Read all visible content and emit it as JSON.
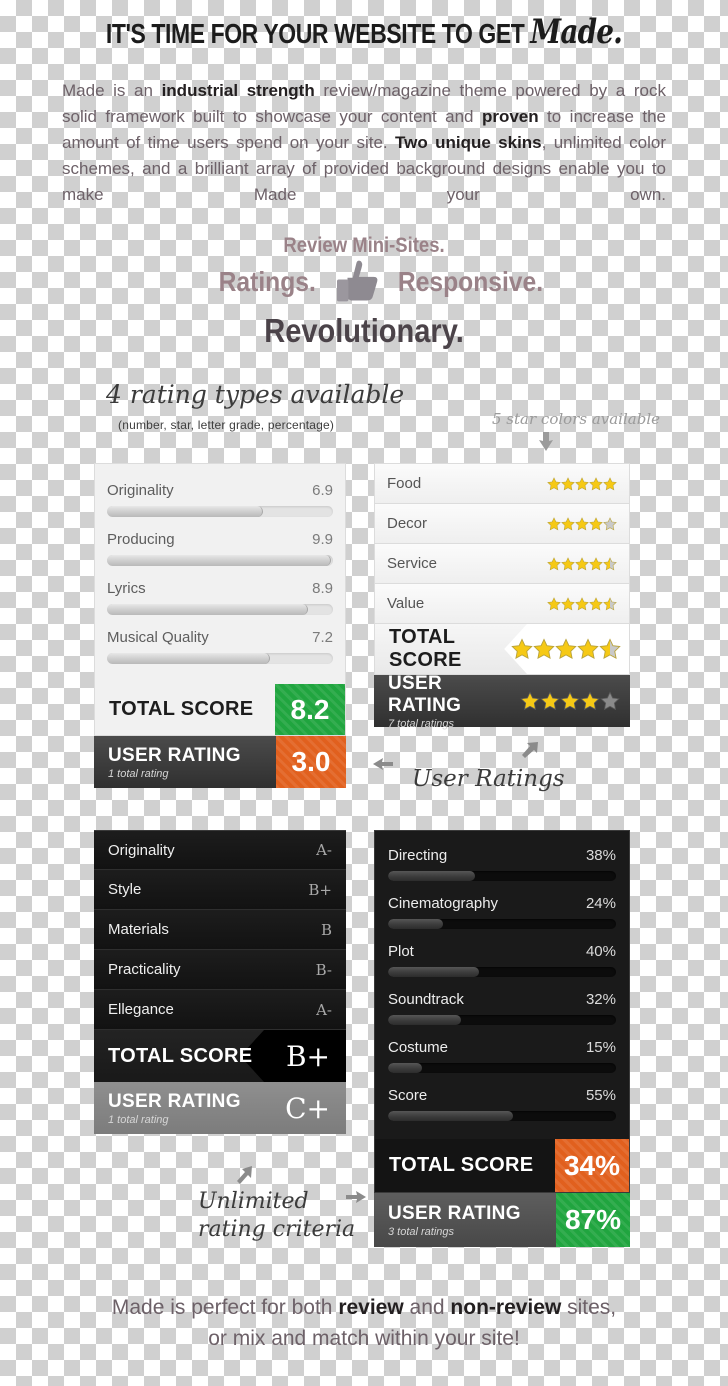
{
  "headline": {
    "lead": "IT'S TIME FOR YOUR WEBSITE TO GET",
    "script": "Made."
  },
  "intro": {
    "p1": "Made is an ",
    "b1": "industrial strength",
    "p2": " review/magazine theme powered by a rock solid framework built to showcase your content and ",
    "b2": "proven",
    "p3": " to increase the amount of time users spend on your site. ",
    "b3": "Two unique skins",
    "p4": ", unlimited color schemes, and a brilliant array of provided background designs enable you to make Made your own."
  },
  "taglines": {
    "mini_sites": "Review Mini-Sites.",
    "ratings": "Ratings.",
    "responsive": "Responsive.",
    "revolutionary": "Revolutionary.",
    "thumb_icon": "thumbs-up-icon"
  },
  "annotations": {
    "four_rating_types": "4 rating types available",
    "four_rating_sub": "(number, star, letter grade, percentage)",
    "five_star_colors": "5 star colors available",
    "user_ratings": "User Ratings",
    "unlimited_line1": "Unlimited",
    "unlimited_line2": "rating criteria"
  },
  "colors": {
    "green": "#20a53f",
    "orange": "#e1601e",
    "star_gold": "#f6c915",
    "star_empty": "#c9c9c9",
    "muted_text": "#6d6168"
  },
  "panel_number": {
    "type": "number",
    "criteria": [
      {
        "name": "Originality",
        "value": "6.9",
        "percent": 69
      },
      {
        "name": "Producing",
        "value": "9.9",
        "percent": 99
      },
      {
        "name": "Lyrics",
        "value": "8.9",
        "percent": 89
      },
      {
        "name": "Musical Quality",
        "value": "7.2",
        "percent": 72
      }
    ],
    "total_label": "TOTAL SCORE",
    "total_value": "8.2",
    "user_label": "USER RATING",
    "user_sub": "1 total rating",
    "user_value": "3.0"
  },
  "panel_star": {
    "type": "star",
    "criteria": [
      {
        "name": "Food",
        "stars": 5
      },
      {
        "name": "Decor",
        "stars": 4
      },
      {
        "name": "Service",
        "stars": 4.5
      },
      {
        "name": "Value",
        "stars": 4.5
      }
    ],
    "total_label": "TOTAL SCORE",
    "total_stars": 4.5,
    "user_label": "USER RATING",
    "user_sub": "7 total ratings",
    "user_stars": 4
  },
  "panel_grade": {
    "type": "letter-grade",
    "criteria": [
      {
        "name": "Originality",
        "grade": "A-"
      },
      {
        "name": "Style",
        "grade": "B+"
      },
      {
        "name": "Materials",
        "grade": "B"
      },
      {
        "name": "Practicality",
        "grade": "B-"
      },
      {
        "name": "Ellegance",
        "grade": "A-"
      }
    ],
    "total_label": "TOTAL SCORE",
    "total_value": "B+",
    "user_label": "USER RATING",
    "user_sub": "1 total rating",
    "user_value": "C+"
  },
  "panel_percent": {
    "type": "percentage",
    "criteria": [
      {
        "name": "Directing",
        "value": "38%",
        "percent": 38
      },
      {
        "name": "Cinematography",
        "value": "24%",
        "percent": 24
      },
      {
        "name": "Plot",
        "value": "40%",
        "percent": 40
      },
      {
        "name": "Soundtrack",
        "value": "32%",
        "percent": 32
      },
      {
        "name": "Costume",
        "value": "15%",
        "percent": 15
      },
      {
        "name": "Score",
        "value": "55%",
        "percent": 55
      }
    ],
    "total_label": "TOTAL SCORE",
    "total_value": "34%",
    "user_label": "USER RATING",
    "user_sub": "3 total ratings",
    "user_value": "87%"
  },
  "footer": {
    "l1a": "Made is perfect for both ",
    "l1b": "review",
    "l1c": " and ",
    "l1d": "non-review",
    "l1e": " sites,",
    "l2": "or mix and match within your site!"
  }
}
